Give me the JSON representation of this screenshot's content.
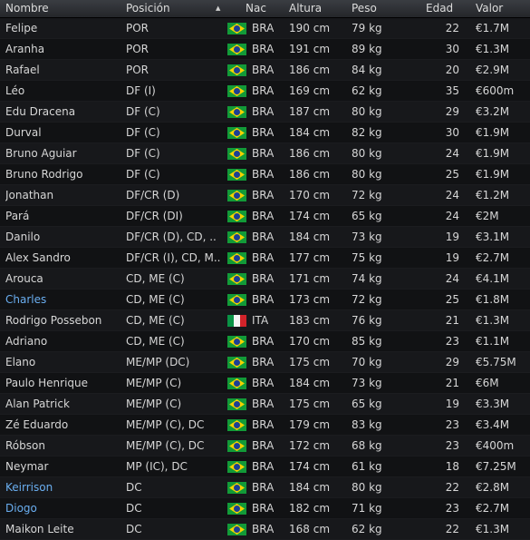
{
  "headers": {
    "name": "Nombre",
    "position": "Posición",
    "nationality": "Nac",
    "height": "Altura",
    "weight": "Peso",
    "age": "Edad",
    "value": "Valor",
    "sort_indicator": "▲"
  },
  "colors": {
    "background": "#111214",
    "text": "#d6d6d6",
    "link_name": "#6aaef0"
  },
  "players": [
    {
      "name": "Felipe",
      "position": "POR",
      "flag_icon": "brazil-flag-icon",
      "nat": "BRA",
      "height": "190 cm",
      "weight": "79 kg",
      "age": "22",
      "value": "€1.7M",
      "highlight": false
    },
    {
      "name": "Aranha",
      "position": "POR",
      "flag_icon": "brazil-flag-icon",
      "nat": "BRA",
      "height": "191 cm",
      "weight": "89 kg",
      "age": "30",
      "value": "€1.3M",
      "highlight": false
    },
    {
      "name": "Rafael",
      "position": "POR",
      "flag_icon": "brazil-flag-icon",
      "nat": "BRA",
      "height": "186 cm",
      "weight": "84 kg",
      "age": "20",
      "value": "€2.9M",
      "highlight": false
    },
    {
      "name": "Léo",
      "position": "DF (I)",
      "flag_icon": "brazil-flag-icon",
      "nat": "BRA",
      "height": "169 cm",
      "weight": "62 kg",
      "age": "35",
      "value": "€600m",
      "highlight": false
    },
    {
      "name": "Edu Dracena",
      "position": "DF (C)",
      "flag_icon": "brazil-flag-icon",
      "nat": "BRA",
      "height": "187 cm",
      "weight": "80 kg",
      "age": "29",
      "value": "€3.2M",
      "highlight": false
    },
    {
      "name": "Durval",
      "position": "DF (C)",
      "flag_icon": "brazil-flag-icon",
      "nat": "BRA",
      "height": "184 cm",
      "weight": "82 kg",
      "age": "30",
      "value": "€1.9M",
      "highlight": false
    },
    {
      "name": "Bruno Aguiar",
      "position": "DF (C)",
      "flag_icon": "brazil-flag-icon",
      "nat": "BRA",
      "height": "186 cm",
      "weight": "80 kg",
      "age": "24",
      "value": "€1.9M",
      "highlight": false
    },
    {
      "name": "Bruno Rodrigo",
      "position": "DF (C)",
      "flag_icon": "brazil-flag-icon",
      "nat": "BRA",
      "height": "186 cm",
      "weight": "80 kg",
      "age": "25",
      "value": "€1.9M",
      "highlight": false
    },
    {
      "name": "Jonathan",
      "position": "DF/CR (D)",
      "flag_icon": "brazil-flag-icon",
      "nat": "BRA",
      "height": "170 cm",
      "weight": "72 kg",
      "age": "24",
      "value": "€1.2M",
      "highlight": false
    },
    {
      "name": "Pará",
      "position": "DF/CR (DI)",
      "flag_icon": "brazil-flag-icon",
      "nat": "BRA",
      "height": "174 cm",
      "weight": "65 kg",
      "age": "24",
      "value": "€2M",
      "highlight": false
    },
    {
      "name": "Danilo",
      "position": "DF/CR (D), CD, ..",
      "flag_icon": "brazil-flag-icon",
      "nat": "BRA",
      "height": "184 cm",
      "weight": "73 kg",
      "age": "19",
      "value": "€3.1M",
      "highlight": false
    },
    {
      "name": "Alex Sandro",
      "position": "DF/CR (I), CD, M..",
      "flag_icon": "brazil-flag-icon",
      "nat": "BRA",
      "height": "177 cm",
      "weight": "75 kg",
      "age": "19",
      "value": "€2.7M",
      "highlight": false
    },
    {
      "name": "Arouca",
      "position": "CD, ME (C)",
      "flag_icon": "brazil-flag-icon",
      "nat": "BRA",
      "height": "171 cm",
      "weight": "74 kg",
      "age": "24",
      "value": "€4.1M",
      "highlight": false
    },
    {
      "name": "Charles",
      "position": "CD, ME (C)",
      "flag_icon": "brazil-flag-icon",
      "nat": "BRA",
      "height": "173 cm",
      "weight": "72 kg",
      "age": "25",
      "value": "€1.8M",
      "highlight": true
    },
    {
      "name": "Rodrigo Possebon",
      "position": "CD, ME (C)",
      "flag_icon": "italy-flag-icon",
      "nat": "ITA",
      "height": "183 cm",
      "weight": "76 kg",
      "age": "21",
      "value": "€1.3M",
      "highlight": false
    },
    {
      "name": "Adriano",
      "position": "CD, ME (C)",
      "flag_icon": "brazil-flag-icon",
      "nat": "BRA",
      "height": "170 cm",
      "weight": "85 kg",
      "age": "23",
      "value": "€1.1M",
      "highlight": false
    },
    {
      "name": "Elano",
      "position": "ME/MP (DC)",
      "flag_icon": "brazil-flag-icon",
      "nat": "BRA",
      "height": "175 cm",
      "weight": "70 kg",
      "age": "29",
      "value": "€5.75M",
      "highlight": false
    },
    {
      "name": "Paulo Henrique",
      "position": "ME/MP (C)",
      "flag_icon": "brazil-flag-icon",
      "nat": "BRA",
      "height": "184 cm",
      "weight": "73 kg",
      "age": "21",
      "value": "€6M",
      "highlight": false
    },
    {
      "name": "Alan Patrick",
      "position": "ME/MP (C)",
      "flag_icon": "brazil-flag-icon",
      "nat": "BRA",
      "height": "175 cm",
      "weight": "65 kg",
      "age": "19",
      "value": "€3.3M",
      "highlight": false
    },
    {
      "name": "Zé Eduardo",
      "position": "ME/MP (C), DC",
      "flag_icon": "brazil-flag-icon",
      "nat": "BRA",
      "height": "179 cm",
      "weight": "83 kg",
      "age": "23",
      "value": "€3.4M",
      "highlight": false
    },
    {
      "name": "Róbson",
      "position": "ME/MP (C), DC",
      "flag_icon": "brazil-flag-icon",
      "nat": "BRA",
      "height": "172 cm",
      "weight": "68 kg",
      "age": "23",
      "value": "€400m",
      "highlight": false
    },
    {
      "name": "Neymar",
      "position": "MP (IC), DC",
      "flag_icon": "brazil-flag-icon",
      "nat": "BRA",
      "height": "174 cm",
      "weight": "61 kg",
      "age": "18",
      "value": "€7.25M",
      "highlight": false
    },
    {
      "name": "Keirrison",
      "position": "DC",
      "flag_icon": "brazil-flag-icon",
      "nat": "BRA",
      "height": "184 cm",
      "weight": "80 kg",
      "age": "22",
      "value": "€2.8M",
      "highlight": true
    },
    {
      "name": "Diogo",
      "position": "DC",
      "flag_icon": "brazil-flag-icon",
      "nat": "BRA",
      "height": "182 cm",
      "weight": "71 kg",
      "age": "23",
      "value": "€2.7M",
      "highlight": true
    },
    {
      "name": "Maikon Leite",
      "position": "DC",
      "flag_icon": "brazil-flag-icon",
      "nat": "BRA",
      "height": "168 cm",
      "weight": "62 kg",
      "age": "22",
      "value": "€1.3M",
      "highlight": false
    }
  ]
}
